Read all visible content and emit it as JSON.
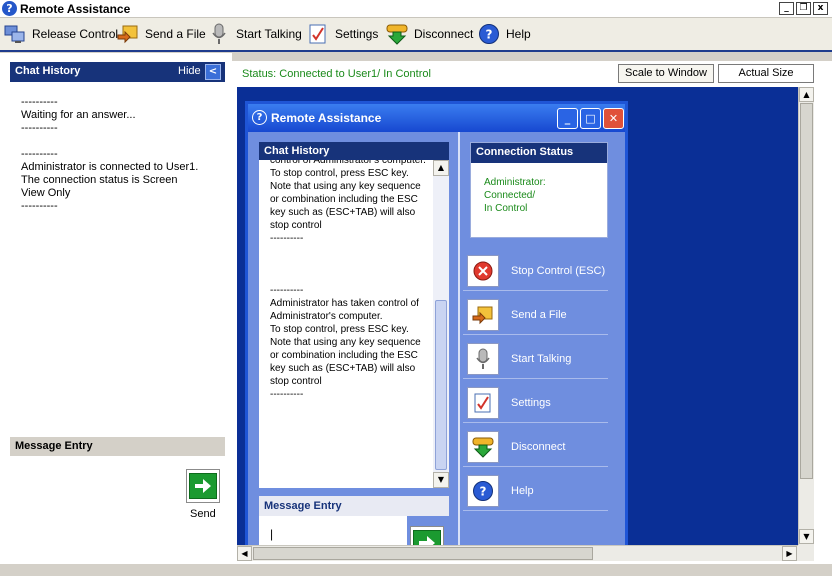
{
  "window": {
    "title": "Remote Assistance",
    "minimize": "_",
    "restore": "❐",
    "close": "x"
  },
  "toolbar": {
    "release_control": "Release Control",
    "send_file": "Send a File",
    "start_talking": "Start Talking",
    "settings": "Settings",
    "disconnect": "Disconnect",
    "help": "Help"
  },
  "left": {
    "chat_history_title": "Chat History",
    "hide_label": "Hide",
    "chat_text": "----------\nWaiting for an answer...\n----------\n\n----------\nAdministrator is connected to User1.\nThe connection status is Screen View Only\n----------",
    "message_entry_title": "Message Entry",
    "send_label": "Send"
  },
  "status_bar": {
    "status": "Status: Connected to User1/ In Control",
    "scale_to_window": "Scale to Window",
    "actual_size": "Actual Size"
  },
  "remote": {
    "title": "Remote Assistance",
    "chat_history_title": "Chat History",
    "chat_text": "control of Administrator's computer.\n To stop control, press ESC key.\nNote that using any key sequence or combination including the ESC key such as (ESC+TAB) will also stop control\n----------\n\n\n\n----------\nAdministrator has taken control of Administrator's computer.\n To stop control, press ESC key.\nNote that using any key sequence or combination including the ESC key such as (ESC+TAB) will also stop control\n----------",
    "message_entry_title": "Message Entry",
    "message_value": "|",
    "connection_status_title": "Connection Status",
    "connection_status_text": "Administrator:\nConnected/\nIn Control",
    "actions": {
      "stop_control": "Stop Control (ESC)",
      "send_file": "Send a File",
      "start_talking": "Start Talking",
      "settings": "Settings",
      "disconnect": "Disconnect",
      "help": "Help"
    }
  },
  "colors": {
    "header_navy": "#17337a",
    "desktop_blue": "#0a2f96",
    "status_green": "#1a8a1a",
    "remote_panel": "#6f8edf"
  }
}
